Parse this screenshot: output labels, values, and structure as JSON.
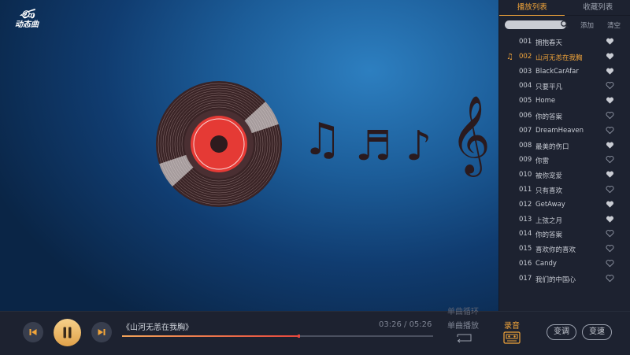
{
  "logo": {
    "mark": "ණ",
    "text": "动态曲"
  },
  "sidebar": {
    "tabs": [
      {
        "label": "播放列表",
        "active": true
      },
      {
        "label": "收藏列表",
        "active": false
      }
    ],
    "search": {
      "placeholder": "",
      "value": ""
    },
    "add_label": "添加",
    "clear_label": "清空",
    "playlist": [
      {
        "num": "001",
        "title": "拥抱春天",
        "fav": true,
        "playing": false
      },
      {
        "num": "002",
        "title": "山河无恙在我胸",
        "fav": true,
        "playing": true
      },
      {
        "num": "003",
        "title": "BlackCarAfar",
        "fav": true,
        "playing": false
      },
      {
        "num": "004",
        "title": "只要平凡",
        "fav": false,
        "playing": false
      },
      {
        "num": "005",
        "title": "Home",
        "fav": true,
        "playing": false
      },
      {
        "num": "006",
        "title": "你的答案",
        "fav": false,
        "playing": false
      },
      {
        "num": "007",
        "title": "DreamHeaven",
        "fav": false,
        "playing": false
      },
      {
        "num": "008",
        "title": "最美的伤口",
        "fav": true,
        "playing": false
      },
      {
        "num": "009",
        "title": "你雷",
        "fav": false,
        "playing": false
      },
      {
        "num": "010",
        "title": "被你宠爱",
        "fav": true,
        "playing": false
      },
      {
        "num": "011",
        "title": "只有喜欢",
        "fav": false,
        "playing": false
      },
      {
        "num": "012",
        "title": "GetAway",
        "fav": true,
        "playing": false
      },
      {
        "num": "013",
        "title": "上弦之月",
        "fav": true,
        "playing": false
      },
      {
        "num": "014",
        "title": "你的答案",
        "fav": false,
        "playing": false
      },
      {
        "num": "015",
        "title": "喜欢你的喜欢",
        "fav": false,
        "playing": false
      },
      {
        "num": "016",
        "title": "Candy",
        "fav": false,
        "playing": false
      },
      {
        "num": "017",
        "title": "我们的中国心",
        "fav": false,
        "playing": false
      }
    ]
  },
  "player": {
    "song_title": "《山河无恙在我胸》",
    "current_time": "03:26",
    "separator": " / ",
    "total_time": "05:26",
    "progress": 0.57,
    "mode_loop": "单曲循环",
    "mode_single": "单曲播放",
    "record_label": "录音",
    "pitch_label": "变调",
    "speed_label": "变速"
  },
  "colors": {
    "accent": "#f2a53a",
    "record_red": "#e53a35",
    "panel": "#1d2230",
    "heart_fav": "#c9ccd3",
    "heart_empty": "#8f95a3"
  },
  "icons": {
    "logo": "logo-icon",
    "search": "search-icon",
    "prev": "previous-icon",
    "pause": "pause-icon",
    "next": "next-icon",
    "heart": "heart-icon",
    "playing": "music-note-icon",
    "mode": "repeat-single-icon",
    "record": "cassette-icon"
  }
}
